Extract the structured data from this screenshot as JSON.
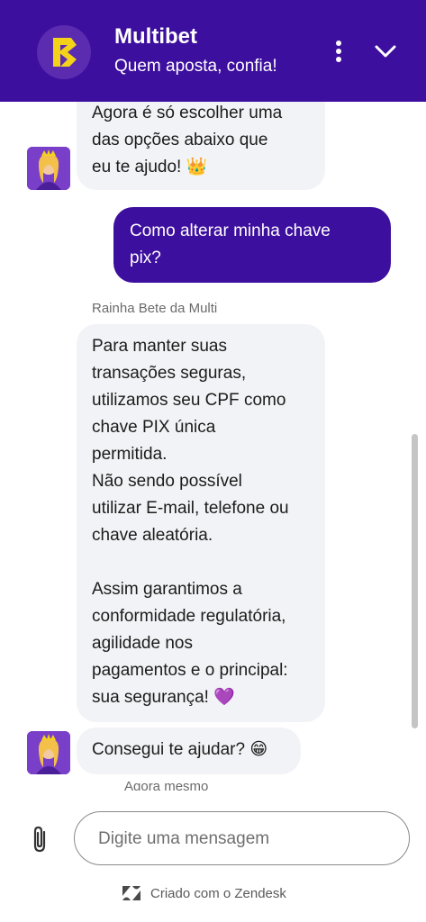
{
  "header": {
    "title": "Multibet",
    "subtitle": "Quem aposta, confia!",
    "logo_icon": "multibet-logo-icon",
    "menu_icon": "vertical-dots-icon",
    "collapse_icon": "chevron-down-icon",
    "brand_color": "#3d0f9e",
    "logo_accent": "#f5d21a"
  },
  "messages": {
    "bot_partial_lines": [
      "Agora é só escolher uma",
      "das opções abaixo que",
      "eu te ajudo! 👑"
    ],
    "user_question_lines": [
      "Como alterar minha chave",
      "pix?"
    ],
    "sender_name": "Rainha Bete da Multi",
    "bot_answer_lines": [
      "Para manter suas",
      "transações seguras,",
      "utilizamos seu CPF como",
      "chave PIX única",
      "permitida.",
      "Não sendo possível",
      "utilizar E-mail, telefone ou",
      "chave aleatória.",
      "",
      "Assim garantimos a",
      "conformidade regulatória,",
      "agilidade nos",
      "pagamentos e o principal:",
      "sua segurança! 💜"
    ],
    "bot_followup": "Consegui te ajudar? 😁",
    "timestamp": "Agora mesmo"
  },
  "composer": {
    "placeholder": "Digite uma mensagem",
    "attach_icon": "paperclip-icon"
  },
  "footer": {
    "label": "Criado com o Zendesk",
    "icon": "zendesk-logo-icon"
  }
}
